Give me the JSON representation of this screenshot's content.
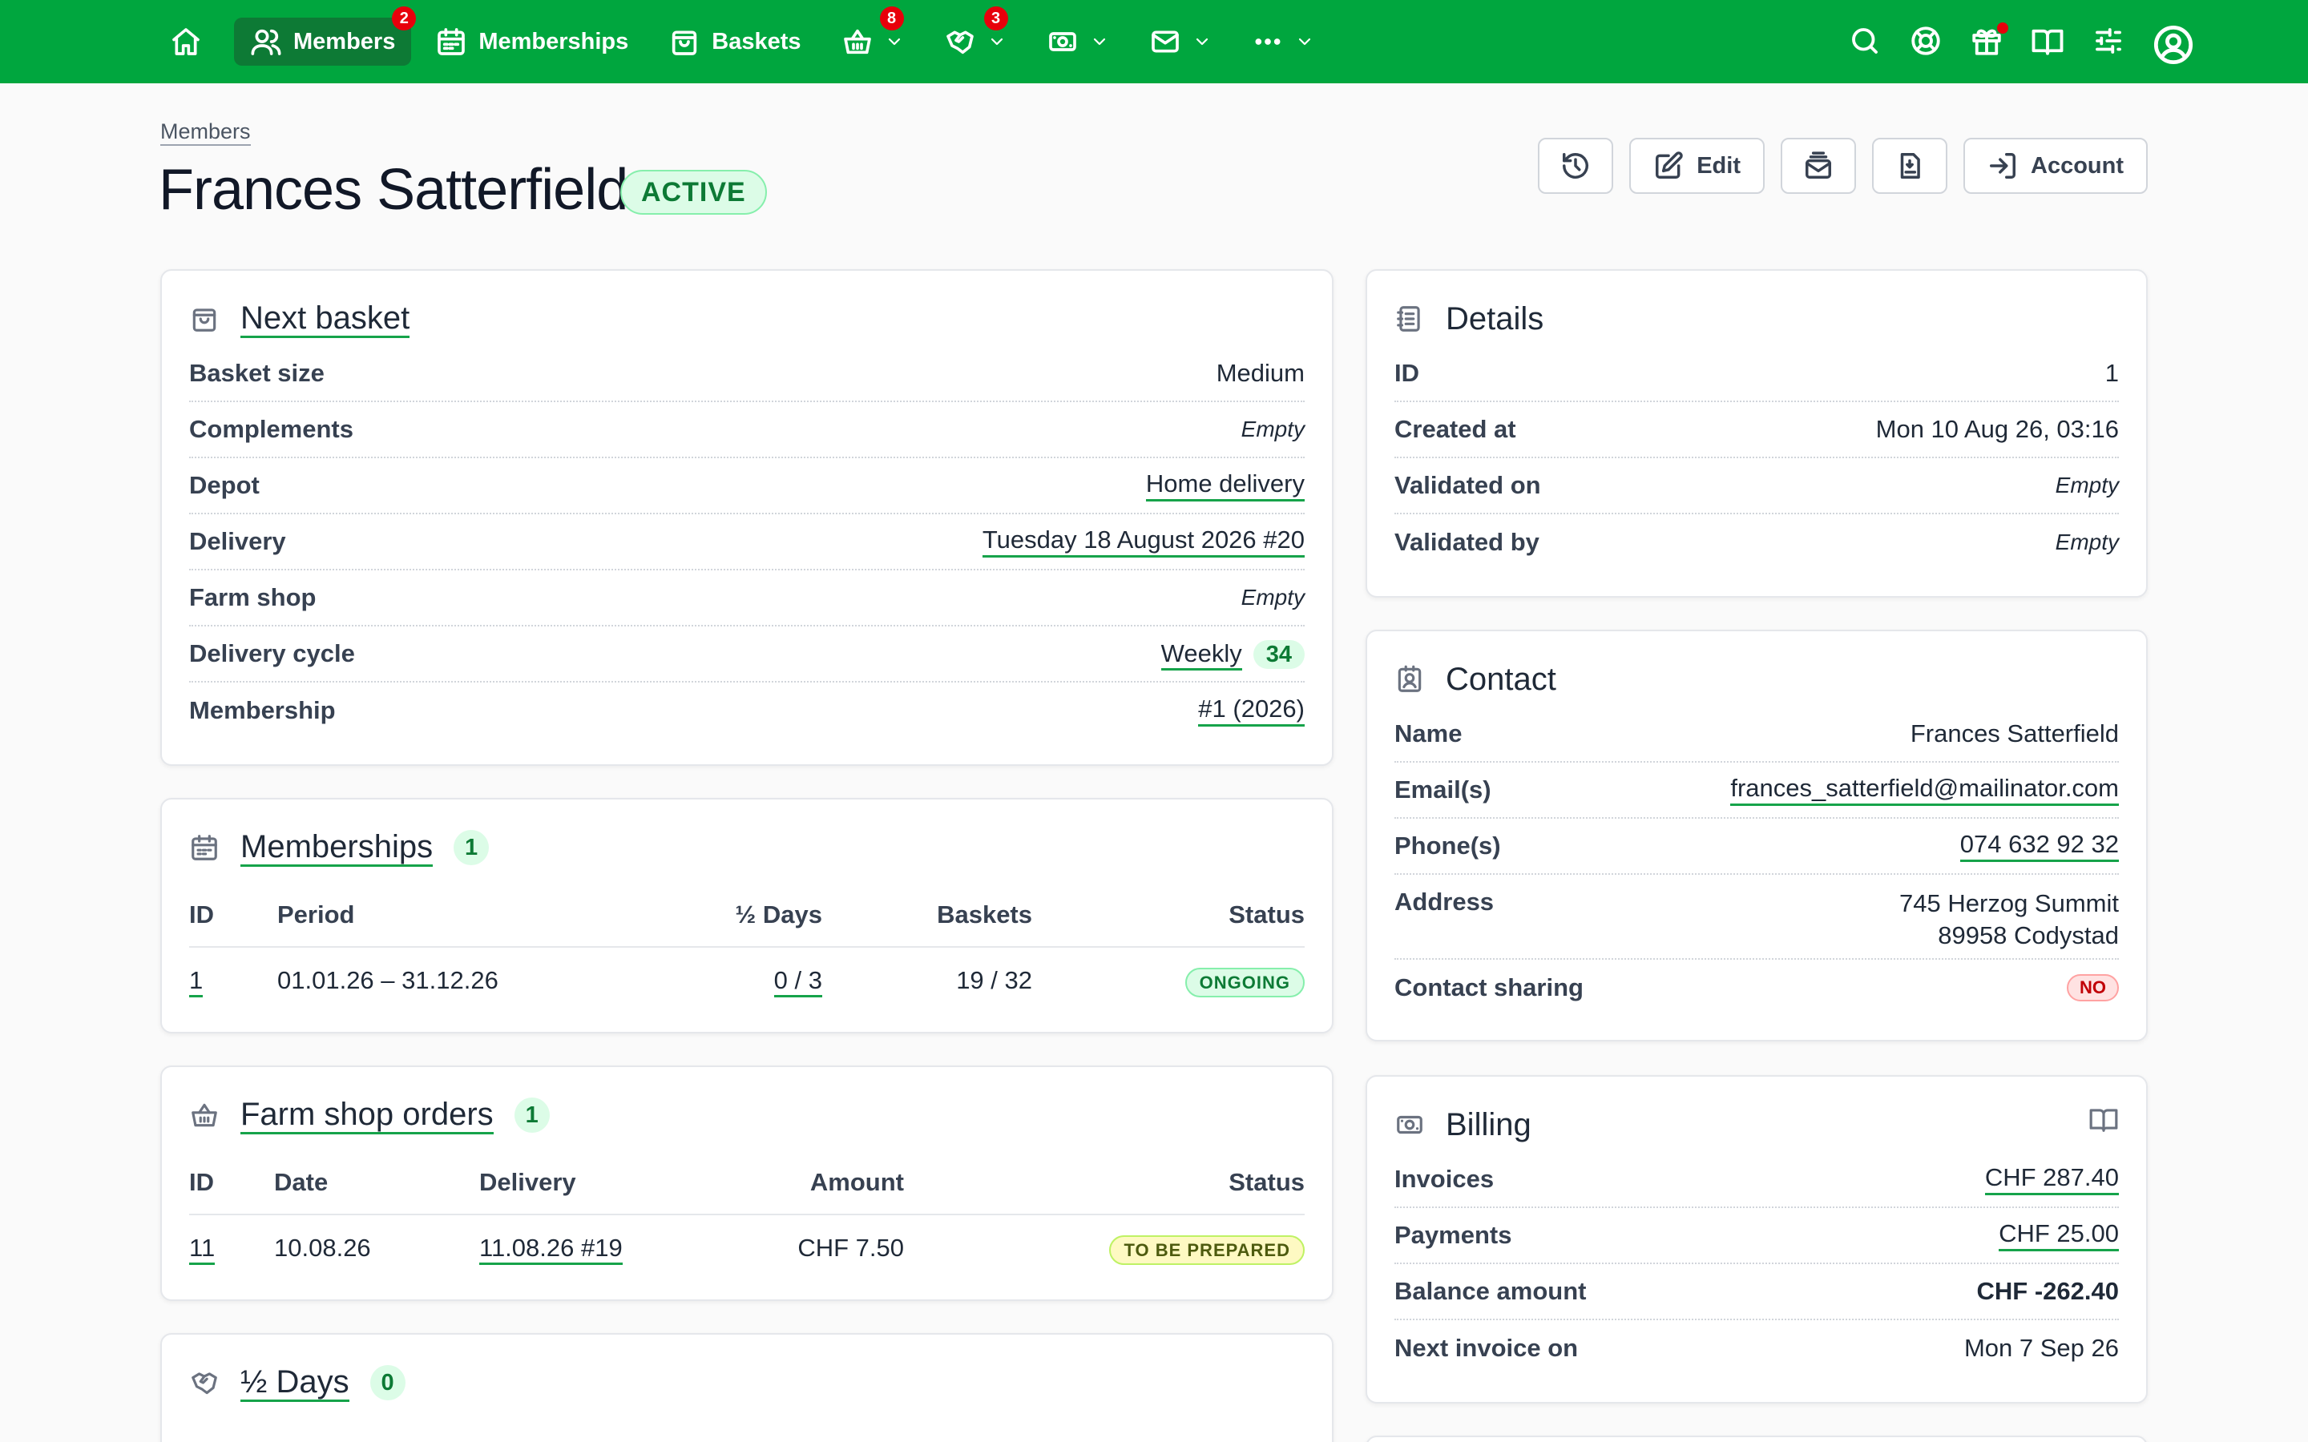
{
  "nav": {
    "home_icon": "home-icon",
    "items": [
      {
        "label": "Members",
        "badge": "2"
      },
      {
        "label": "Memberships"
      },
      {
        "label": "Baskets"
      }
    ],
    "basket_badge": "8",
    "halfdays_badge": "3"
  },
  "header": {
    "breadcrumb": "Members",
    "title": "Frances Satterfield",
    "status": "ACTIVE",
    "edit_label": "Edit",
    "account_label": "Account"
  },
  "next_basket": {
    "title": "Next basket",
    "rows": {
      "basket_size": {
        "label": "Basket size",
        "value": "Medium"
      },
      "complements": {
        "label": "Complements",
        "value": "Empty"
      },
      "depot": {
        "label": "Depot",
        "value": "Home delivery"
      },
      "delivery": {
        "label": "Delivery",
        "value": "Tuesday 18 August 2026 #20"
      },
      "farm_shop": {
        "label": "Farm shop",
        "value": "Empty"
      },
      "cycle": {
        "label": "Delivery cycle",
        "value": "Weekly",
        "count": "34"
      },
      "membership": {
        "label": "Membership",
        "value": "#1 (2026)"
      }
    }
  },
  "memberships": {
    "title": "Memberships",
    "count": "1",
    "columns": [
      "ID",
      "Period",
      "½ Days",
      "Baskets",
      "Status"
    ],
    "rows": [
      {
        "id": "1",
        "period": "01.01.26 – 31.12.26",
        "half_days": "0 / 3",
        "baskets": "19 / 32",
        "status": "ONGOING"
      }
    ]
  },
  "farm_shop_orders": {
    "title": "Farm shop orders",
    "count": "1",
    "columns": [
      "ID",
      "Date",
      "Delivery",
      "Amount",
      "Status"
    ],
    "rows": [
      {
        "id": "11",
        "date": "10.08.26",
        "delivery": "11.08.26 #19",
        "amount": "CHF 7.50",
        "status": "TO BE PREPARED"
      }
    ]
  },
  "half_days": {
    "title": "½ Days",
    "count": "0"
  },
  "details": {
    "title": "Details",
    "rows": {
      "id": {
        "label": "ID",
        "value": "1"
      },
      "created": {
        "label": "Created at",
        "value": "Mon 10 Aug 26, 03:16"
      },
      "validated_on": {
        "label": "Validated on",
        "value": "Empty"
      },
      "validated_by": {
        "label": "Validated by",
        "value": "Empty"
      }
    }
  },
  "contact": {
    "title": "Contact",
    "rows": {
      "name": {
        "label": "Name",
        "value": "Frances Satterfield"
      },
      "emails": {
        "label": "Email(s)",
        "value": "frances_satterfield@mailinator.com"
      },
      "phones": {
        "label": "Phone(s)",
        "value": "074 632 92 32"
      },
      "address": {
        "label": "Address",
        "line1": "745 Herzog Summit",
        "line2": "89958 Codystad"
      },
      "sharing": {
        "label": "Contact sharing",
        "value": "NO"
      }
    }
  },
  "billing": {
    "title": "Billing",
    "rows": {
      "invoices": {
        "label": "Invoices",
        "value": "CHF 287.40"
      },
      "payments": {
        "label": "Payments",
        "value": "CHF 25.00"
      },
      "balance": {
        "label": "Balance amount",
        "value": "CHF -262.40"
      },
      "next_invoice": {
        "label": "Next invoice on",
        "value": "Mon 7 Sep 26"
      }
    }
  },
  "colors": {
    "brand": "#00a63e",
    "brand_dark": "#0d7a35",
    "badge": "#e7000b"
  }
}
